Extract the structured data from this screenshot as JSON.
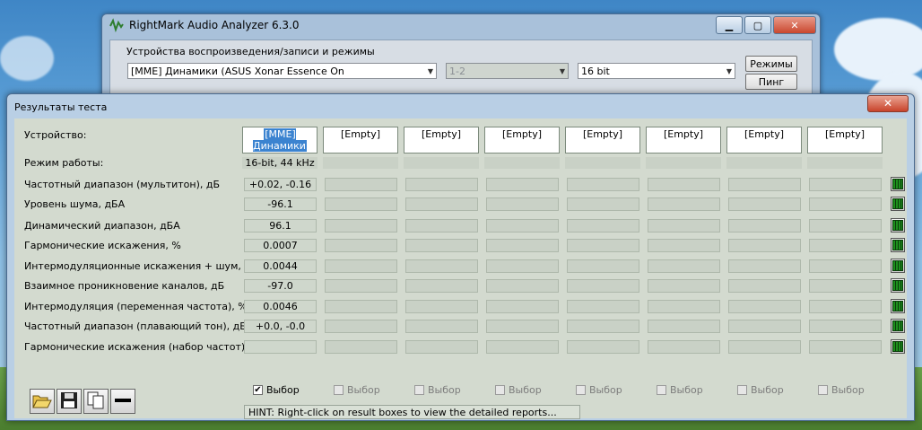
{
  "main_window": {
    "title": "RightMark Audio Analyzer 6.3.0",
    "group_label": "Устройства воспроизведения/записи и режимы",
    "device_combo": "[MME] Динамики (ASUS Xonar Essence On",
    "channels_combo": "1-2",
    "bits_combo": "16 bit",
    "modes_button": "Режимы",
    "ping_button": "Пинг"
  },
  "results_window": {
    "title": "Результаты теста",
    "close_label": "✕",
    "device_label": "Устройство:",
    "mode_label": "Режим работы:",
    "devices": [
      "[MME] Динамики",
      "[Empty]",
      "[Empty]",
      "[Empty]",
      "[Empty]",
      "[Empty]",
      "[Empty]",
      "[Empty]"
    ],
    "mode_value": "16-bit, 44 kHz",
    "rows": [
      {
        "label": "Частотный диапазон (мультитон), дБ",
        "value": "+0.02, -0.16"
      },
      {
        "label": "Уровень шума, дБА",
        "value": "-96.1"
      },
      {
        "label": "Динамический диапазон, дБА",
        "value": "96.1"
      },
      {
        "label": "Гармонические искажения, %",
        "value": "0.0007"
      },
      {
        "label": "Интермодуляционные искажения + шум, %",
        "value": "0.0044"
      },
      {
        "label": "Взаимное проникновение каналов, дБ",
        "value": "-97.0"
      },
      {
        "label": "Интермодуляция (переменная частота), %",
        "value": "0.0046"
      },
      {
        "label": "Частотный диапазон (плавающий тон), дБ",
        "value": "+0.0, -0.0"
      },
      {
        "label": "Гармонические искажения (набор частот)",
        "value": ""
      }
    ],
    "select_label": "Выбор",
    "hint": "HINT: Right-click on result boxes to view the detailed reports..."
  },
  "colors": {
    "selection": "#3b83d0",
    "grid_icon": "#1d8f1d"
  }
}
